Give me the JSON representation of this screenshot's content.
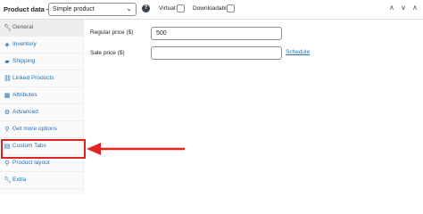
{
  "header": {
    "title": "Product data —",
    "product_type": "Simple product",
    "virtual_label": "Virtual:",
    "downloadable_label": "Downloadable:"
  },
  "sidebar": {
    "items": [
      {
        "label": "General",
        "icon": "wrench-icon"
      },
      {
        "label": "Inventory",
        "icon": "tag-icon"
      },
      {
        "label": "Shipping",
        "icon": "truck-icon"
      },
      {
        "label": "Linked Products",
        "icon": "link-icon"
      },
      {
        "label": "Attributes",
        "icon": "table-icon"
      },
      {
        "label": "Advanced",
        "icon": "gear-icon"
      },
      {
        "label": "Get more options",
        "icon": "plugin-icon"
      },
      {
        "label": "Custom Tabs",
        "icon": "table-icon"
      },
      {
        "label": "Product layout",
        "icon": "plugin-icon"
      },
      {
        "label": "Extra",
        "icon": "wrench-icon"
      }
    ],
    "active_index": 0
  },
  "general": {
    "regular_price_label": "Regular price ($)",
    "regular_price_value": "500",
    "sale_price_label": "Sale price ($)",
    "sale_price_value": "",
    "schedule_link": "Schedule"
  },
  "colors": {
    "accent": "#2271b1",
    "highlight": "#e02424"
  }
}
